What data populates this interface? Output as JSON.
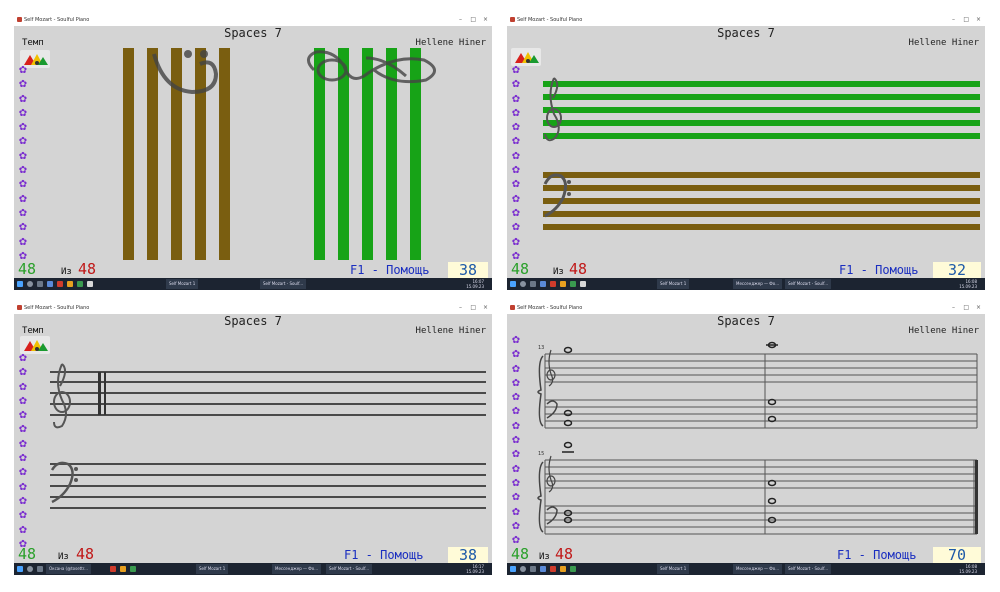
{
  "panels": [
    {
      "window_title": "Self Mozart - Soulful Piano",
      "heading": "Spaces 7",
      "author": "Hellene Hiner",
      "tempo": "Темп",
      "score": "48",
      "of_label": "Из",
      "of_total": "48",
      "help": "F1 - Помощь",
      "counter": "38"
    },
    {
      "window_title": "Self Mozart - Soulful Piano",
      "heading": "Spaces 7",
      "author": "Hellene Hiner",
      "score": "48",
      "of_label": "Из",
      "of_total": "48",
      "help": "F1 - Помощь",
      "counter": "32"
    },
    {
      "window_title": "Self Mozart - Soulful Piano",
      "heading": "Spaces 7",
      "author": "Hellene Hiner",
      "tempo": "Темп",
      "score": "48",
      "of_label": "Из",
      "of_total": "48",
      "help": "F1 - Помощь",
      "counter": "38"
    },
    {
      "window_title": "Self Mozart - Soulful Piano",
      "heading": "Spaces 7",
      "author": "Hellene Hiner",
      "score": "48",
      "of_label": "Из",
      "of_total": "48",
      "help": "F1 - Помощь",
      "counter": "70",
      "measure_numbers": [
        "13",
        "15"
      ]
    }
  ],
  "taskbar": {
    "tasks_1": [
      "Self Mozart 1",
      "Self Mozart - Soulf..."
    ],
    "tasks_2": [
      "Self Mozart 1",
      "Мессенджер — Фо...",
      "Self Mozart - Soulf..."
    ],
    "tasks_3": [
      "Оксана (@tosettr...",
      "Self Mozart 1",
      "Мессенджер — Фо...",
      "Self Mozart - Soulf..."
    ],
    "tasks_4": [
      "Self Mozart 1",
      "Мессенджер — Фо...",
      "Self Mozart - Soulf..."
    ],
    "tray_lang": "РУС",
    "time_1": "16:07",
    "date_1": "15.09.23",
    "time_2": "16:08",
    "date_2": "15.09.23",
    "time_3": "16:17",
    "date_3": "15.09.23",
    "time_4": "16:08",
    "date_4": "15.09.23"
  },
  "icons": {
    "note": "note-icon",
    "star": "star-icon",
    "treble": "treble-clef-icon",
    "bass": "bass-clef-icon",
    "gauge": "tempo-gauge-icon",
    "windows": "windows-icon",
    "search": "search-icon"
  },
  "colors": {
    "background": "#d4d4d4",
    "green_lines": "#17a317",
    "brown_lines": "#7a5e10",
    "star": "#7a2ccf",
    "score_green": "#2aa02a",
    "total_red": "#c01818",
    "help_blue": "#1a2ec0",
    "counter_bg": "#fffbd8"
  }
}
